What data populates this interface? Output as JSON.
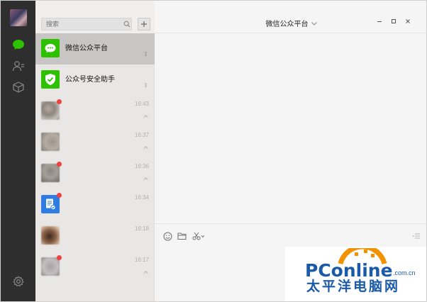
{
  "search": {
    "placeholder": "搜索"
  },
  "chat": {
    "title": "微信公众平台"
  },
  "conversations": [
    {
      "name": "微信公众平台",
      "time": "",
      "selected": true,
      "unread": false
    },
    {
      "name": "公众号安全助手",
      "time": "",
      "selected": false,
      "unread": false
    },
    {
      "name": "",
      "time": "16:43",
      "selected": false,
      "unread": true
    },
    {
      "name": "",
      "time": "16:37",
      "selected": false,
      "unread": false
    },
    {
      "name": "",
      "time": "16:36",
      "selected": false,
      "unread": true
    },
    {
      "name": "",
      "time": "16:34",
      "selected": false,
      "unread": true
    },
    {
      "name": "",
      "time": "16:18",
      "selected": false,
      "unread": false
    },
    {
      "name": "",
      "time": "16:17",
      "selected": false,
      "unread": true
    }
  ],
  "watermark": {
    "brand": "PConline",
    "domain": ".com.cn",
    "cn": "太平洋电脑网"
  },
  "colors": {
    "sidebar": "#2e2e2e",
    "wechat_green": "#2dc100",
    "selected": "#c8c6c5",
    "badge": "#f0413f",
    "brand_blue": "#1a5aa8",
    "brand_orange": "#f29200"
  },
  "icons": [
    "chat-icon",
    "contacts-icon",
    "favorites-icon",
    "settings-icon",
    "search-icon",
    "plus-icon",
    "emoji-icon",
    "folder-icon",
    "scissors-icon",
    "history-icon"
  ]
}
